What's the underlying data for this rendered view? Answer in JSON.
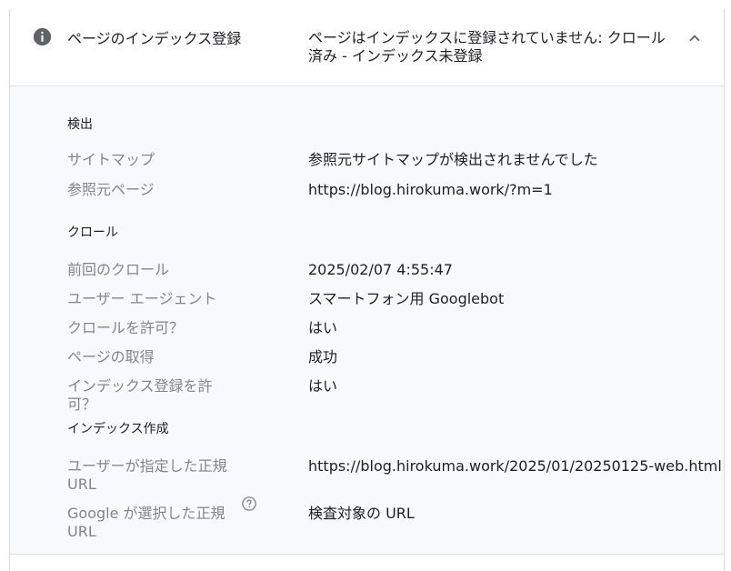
{
  "header": {
    "title": "ページのインデックス登録",
    "status_line1": "ページはインデックスに登録されていません: クロール",
    "status_line2": "済み - インデックス未登録",
    "icon": "info-icon",
    "toggle_icon": "chevron-up-icon"
  },
  "sections": {
    "discovery": {
      "title": "検出",
      "rows": [
        {
          "label": "サイトマップ",
          "value": "参照元サイトマップが検出されませんでした"
        },
        {
          "label": "参照元ページ",
          "value": "https://blog.hirokuma.work/?m=1"
        }
      ]
    },
    "crawl": {
      "title": "クロール",
      "rows": [
        {
          "label": "前回のクロール",
          "value": "2025/02/07 4:55:47"
        },
        {
          "label": "ユーザー エージェント",
          "value": "スマートフォン用 Googlebot"
        },
        {
          "label": "クロールを許可？",
          "value": "はい"
        },
        {
          "label": "ページの取得",
          "value": "成功"
        },
        {
          "label": "インデックス登録を許可？",
          "value": "はい"
        }
      ]
    },
    "indexing": {
      "title": "インデックス作成",
      "rows": [
        {
          "label_line1": "ユーザーが指定した正規",
          "label_line2": "URL",
          "value": "https://blog.hirokuma.work/2025/01/20250125-web.html"
        },
        {
          "label_line1": "Google が選択した正規",
          "label_line2": "URL",
          "value": "検査対象の URL",
          "help_icon": "help-circle-icon"
        }
      ]
    }
  },
  "colors": {
    "label_gray": "#80868b",
    "text": "#202124",
    "body_bg": "#f8f9fa",
    "border": "#dadce0",
    "icon_gray": "#5f6368"
  }
}
